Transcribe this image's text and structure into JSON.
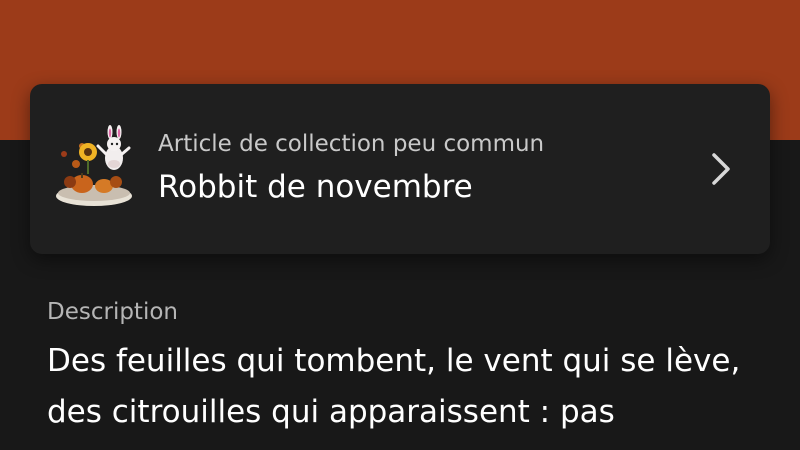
{
  "item": {
    "rarity_label": "Article de collection peu commun",
    "name": "Robbit de novembre",
    "thumbnail_icon": "autumn-robbit-collectible-icon",
    "chevron_icon": "chevron-right-icon"
  },
  "description": {
    "label": "Description",
    "text": "Des feuilles qui tombent, le vent qui se lève, des citrouilles qui apparaissent : pas"
  },
  "colors": {
    "header_band": "#9c3b19",
    "background": "#181818",
    "card": "#1f1f1f"
  }
}
